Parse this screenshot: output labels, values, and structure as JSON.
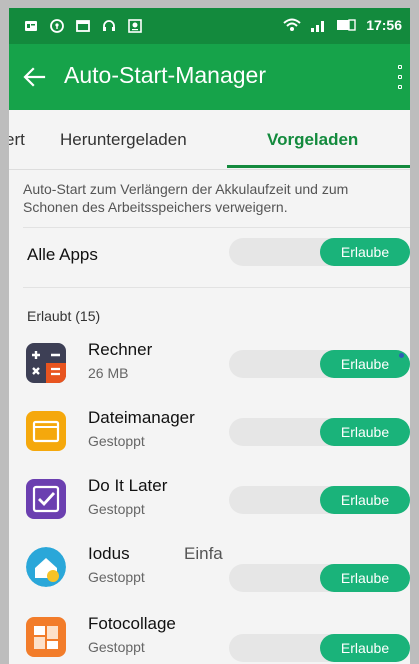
{
  "status": {
    "time": "17:56",
    "icons_left": [
      "sim-card-icon",
      "vpn-key-icon",
      "calendar-icon",
      "headphones-icon",
      "record-icon"
    ],
    "icons_right": [
      "wifi-icon",
      "signal-icon",
      "battery-icon"
    ]
  },
  "appbar": {
    "title": "Auto-Start-Manager"
  },
  "tabs": [
    {
      "label": "ert",
      "active": false
    },
    {
      "label": "Heruntergeladen",
      "active": false
    },
    {
      "label": "Vorgeladen",
      "active": true
    }
  ],
  "description": "Auto-Start zum Verlängern der Akkulaufzeit und zum Schonen des Arbeitsspeichers verweigern.",
  "all_apps": {
    "label": "Alle Apps",
    "toggle_label": "Erlaube"
  },
  "section": {
    "label": "Erlaubt (15)"
  },
  "apps": [
    {
      "name": "Rechner",
      "sub": "26 MB",
      "toggle_label": "Erlaube",
      "icon": "calculator-icon"
    },
    {
      "name": "Dateimanager",
      "sub": "Gestoppt",
      "toggle_label": "Erlaube",
      "icon": "folder-icon"
    },
    {
      "name": "Do It Later",
      "sub": "Gestoppt",
      "toggle_label": "Erlaube",
      "icon": "checkmark-icon"
    },
    {
      "name": "Iodus",
      "name2": "Einfa",
      "sub": "Gestoppt",
      "toggle_label": "Erlaube",
      "icon": "home-launcher-icon"
    },
    {
      "name": "Fotocollage",
      "sub": "Gestoppt",
      "toggle_label": "Erlaube",
      "icon": "photo-collage-icon"
    }
  ],
  "colors": {
    "status_bar": "#138a3d",
    "app_bar": "#16a34a",
    "accent": "#138a3d",
    "toggle_on": "#1ab37a"
  }
}
